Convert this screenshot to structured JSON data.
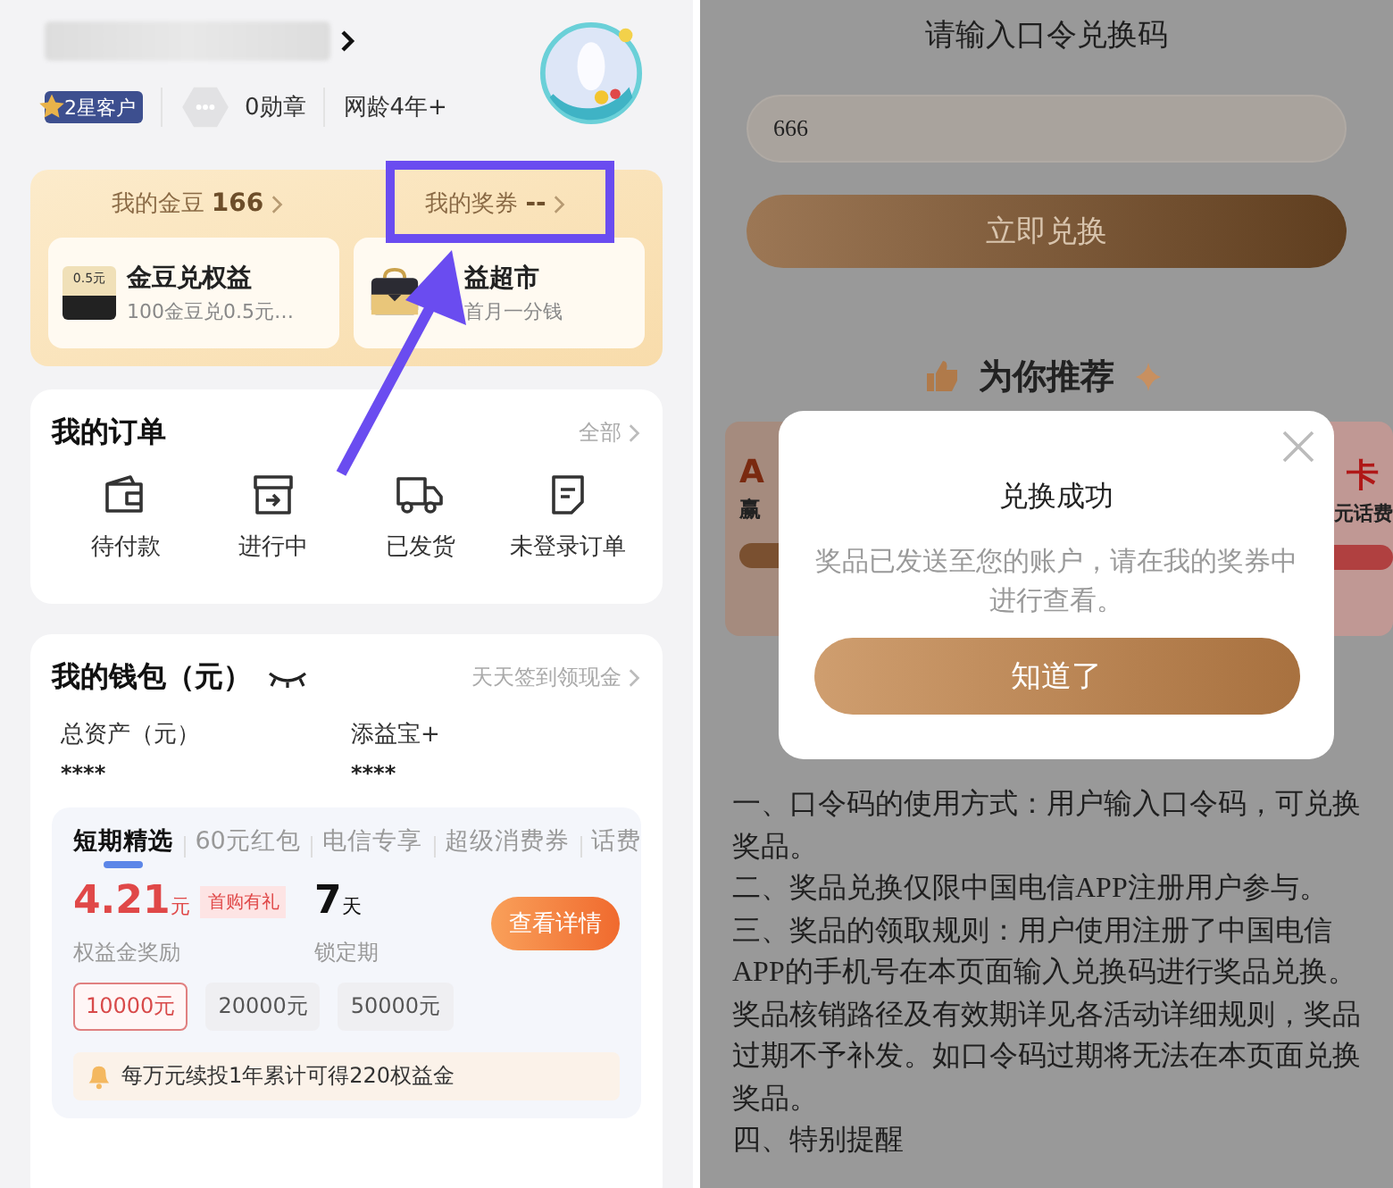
{
  "profile": {
    "badge": "2星客户",
    "medals": "0勋章",
    "tenure": "网龄4年+"
  },
  "gold_card": {
    "items": [
      {
        "label": "我的金豆",
        "value": "166"
      },
      {
        "label": "我的奖券",
        "value": "--"
      }
    ],
    "tiles": [
      {
        "icon_text": "0.5元",
        "title": "金豆兑权益",
        "subtitle": "100金豆兑0.5元…"
      },
      {
        "title": "益超市",
        "subtitle": "首月一分钱"
      }
    ]
  },
  "orders": {
    "title": "我的订单",
    "link": "全部",
    "items": [
      {
        "label": "待付款"
      },
      {
        "label": "进行中"
      },
      {
        "label": "已发货"
      },
      {
        "label": "未登录订单"
      }
    ]
  },
  "wallet": {
    "title": "我的钱包（元）",
    "link": "天天签到领现金",
    "assets": [
      {
        "label": "总资产（元）",
        "value": "****"
      },
      {
        "label": "添益宝+",
        "value": "****"
      }
    ],
    "tabs": [
      {
        "label": "短期精选",
        "selected": true
      },
      {
        "label": "60元红包",
        "selected": false
      },
      {
        "label": "电信专享",
        "selected": false
      },
      {
        "label": "超级消费券",
        "selected": false
      },
      {
        "label": "话费",
        "selected": false
      }
    ],
    "product": {
      "amount": "4.21",
      "unit": "元",
      "tag": "首购有礼",
      "amount_label": "权益金奖励",
      "period": "7",
      "period_unit": "天",
      "period_label": "锁定期",
      "button": "查看详情",
      "options": [
        {
          "label": "10000元",
          "selected": true
        },
        {
          "label": "20000元",
          "selected": false
        },
        {
          "label": "50000元",
          "selected": false
        }
      ],
      "note": "每万元续投1年累计可得220权益金"
    }
  },
  "redeem": {
    "title": "请输入口令兑换码",
    "input_value": "666",
    "button": "立即兑换",
    "recommend_title": "为你推荐",
    "hidden_cards": [
      {
        "heading": "A",
        "line": "赢"
      },
      {
        "heading": "卡",
        "line": "元话费"
      }
    ],
    "rules": [
      "一、口令码的使用方式：用户输入口令码，可兑换奖品。",
      "二、奖品兑换仅限中国电信APP注册用户参与。",
      "三、奖品的领取规则：用户使用注册了中国电信APP的手机号在本页面输入兑换码进行奖品兑换。奖品核销路径及有效期详见各活动详细规则，奖品过期不予补发。如口令码过期将无法在本页面兑换奖品。",
      "四、特别提醒"
    ]
  },
  "dialog": {
    "title": "兑换成功",
    "message": "奖品已发送至您的账户，请在我的奖券中进行查看。",
    "button": "知道了"
  }
}
